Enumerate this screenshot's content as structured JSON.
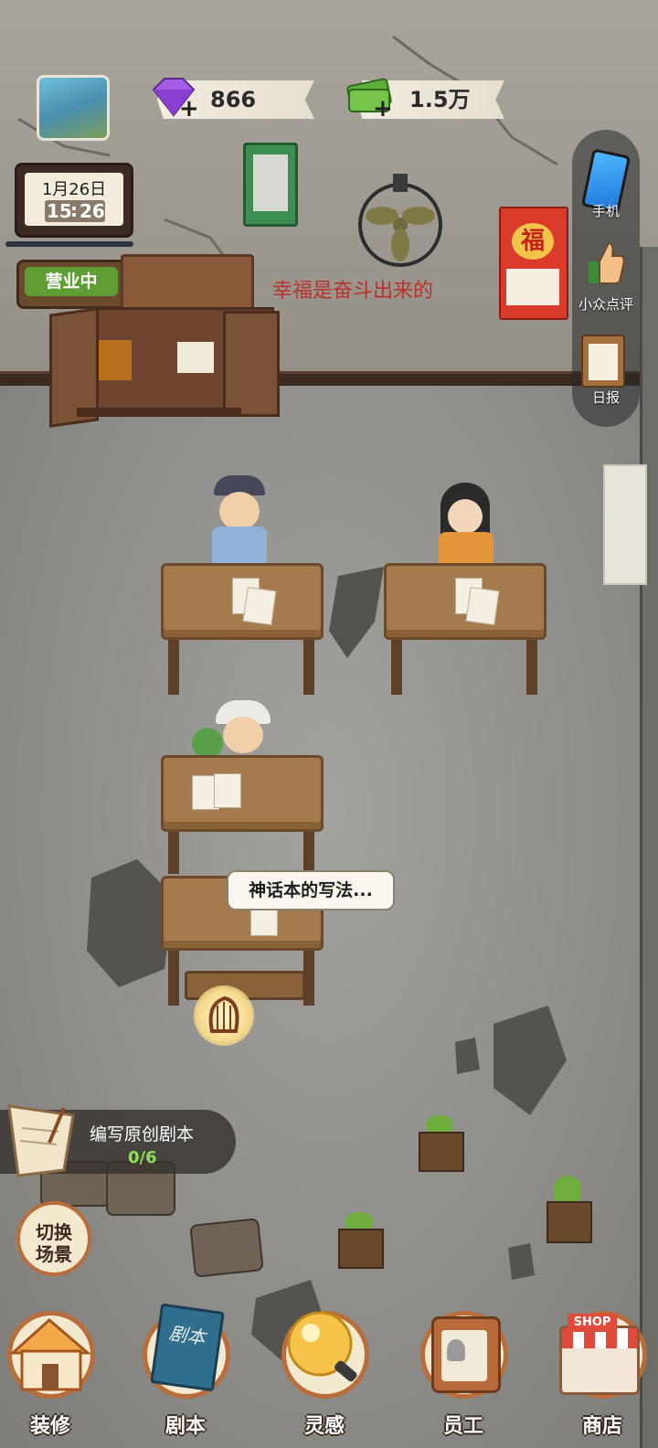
{
  "resources": {
    "gems": "866",
    "money": "1.5万",
    "plus": "+"
  },
  "calendar": {
    "date": "1月26日",
    "hour": "15",
    "colon": ":",
    "minute": "26"
  },
  "shop_sign": "营业中",
  "wall_slogan": "幸福是奋斗出来的",
  "fu_calendar": {
    "character": "福"
  },
  "side_menu": [
    {
      "label": "手机",
      "icon": "phone-icon"
    },
    {
      "label": "小众点评",
      "icon": "thumbs-up-icon"
    },
    {
      "label": "日报",
      "icon": "clipboard-icon"
    }
  ],
  "speech_bubble": "神话本的写法...",
  "task": {
    "title": "编写原创剧本",
    "progress": "0/6",
    "value": 0,
    "total": 6
  },
  "switch_scene": {
    "line1": "切换",
    "line2": "场景"
  },
  "nav": [
    {
      "label": "装修",
      "icon": "house-icon"
    },
    {
      "label": "剧本",
      "icon": "script-book-icon",
      "book_text": "剧本"
    },
    {
      "label": "灵感",
      "icon": "lightbulb-icon"
    },
    {
      "label": "员工",
      "icon": "staff-badge-icon"
    },
    {
      "label": "商店",
      "icon": "shop-icon",
      "sign_text": "SHOP"
    }
  ],
  "colors": {
    "accent_brown": "#b86d3a",
    "sign_green": "#5e9e35",
    "desk_wood": "#a57a4c"
  }
}
